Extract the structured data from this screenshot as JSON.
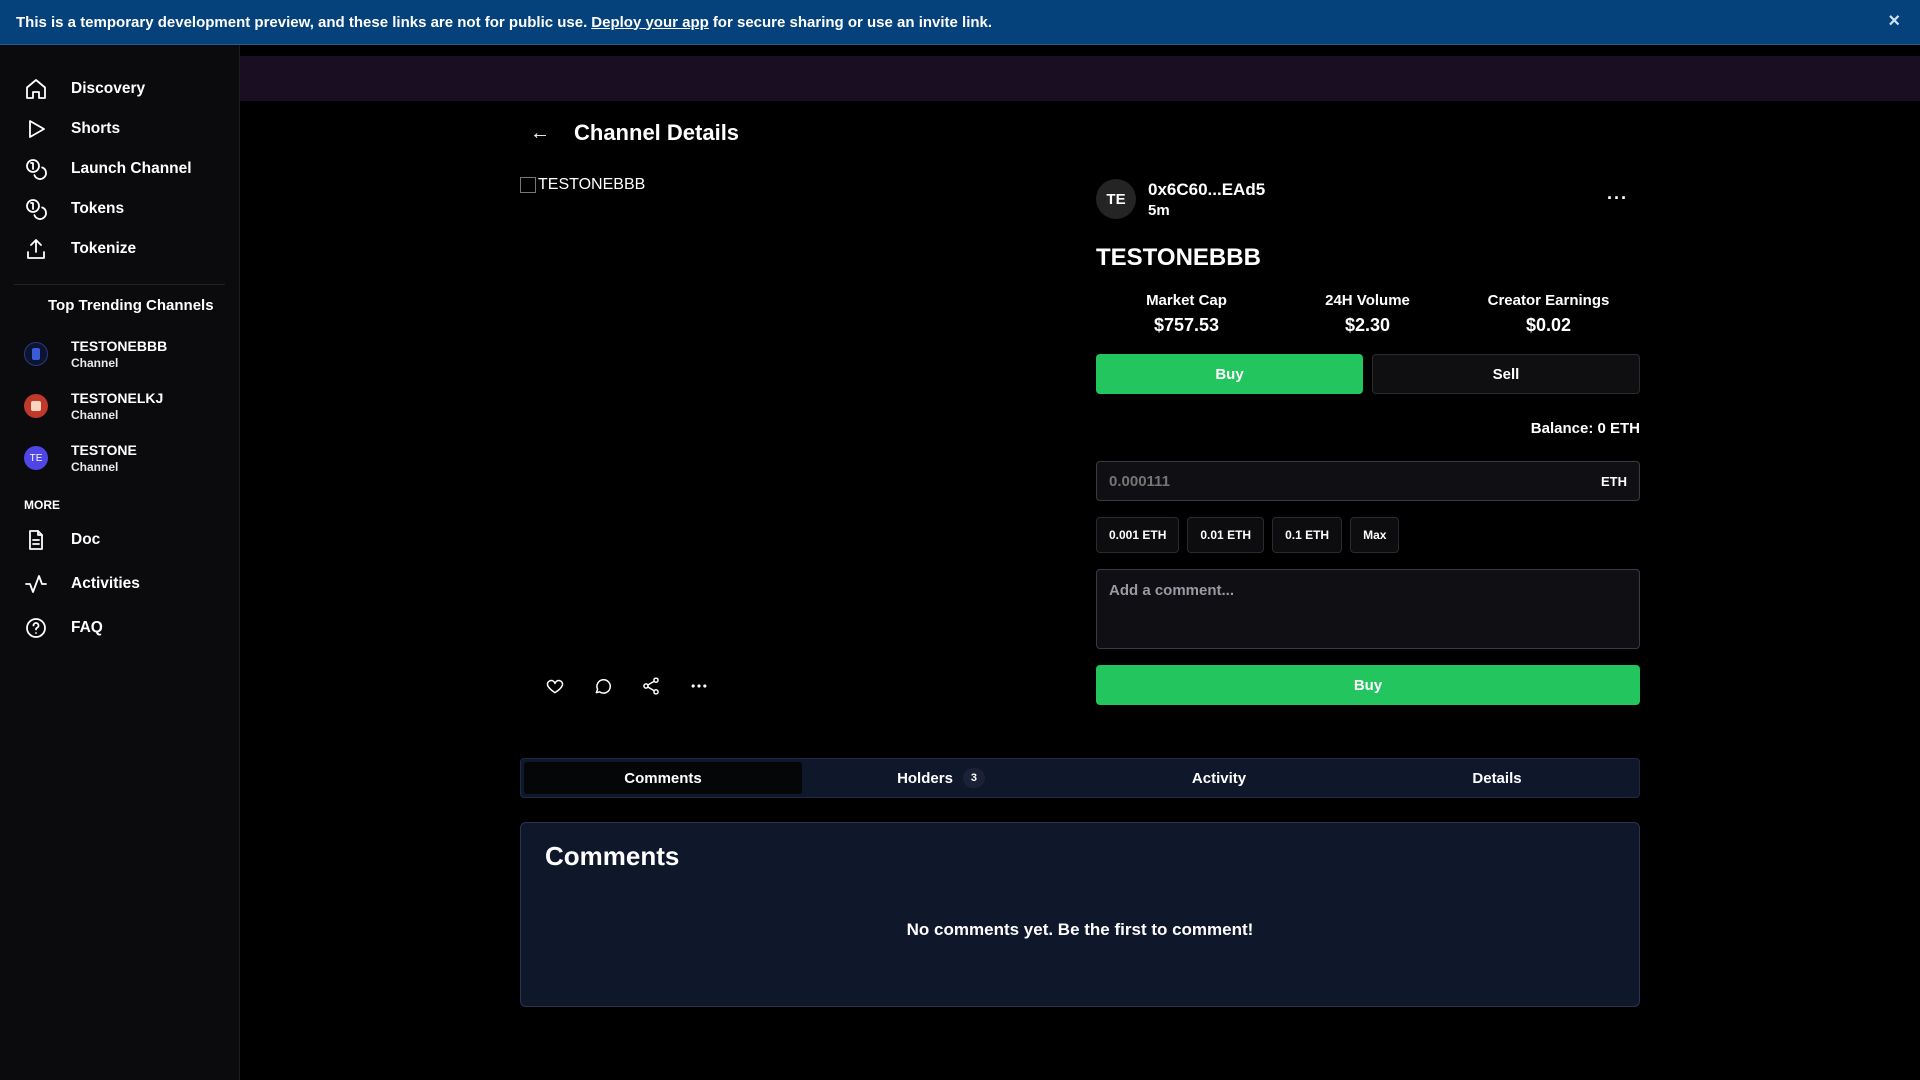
{
  "banner": {
    "text_before": "This is a temporary development preview, and these links are not for public use.",
    "link": "Deploy your app",
    "text_after": "for secure sharing or use an invite link.",
    "close": "×"
  },
  "sidebar": {
    "nav": [
      {
        "label": "Discovery",
        "icon": "home-icon"
      },
      {
        "label": "Shorts",
        "icon": "play-icon"
      },
      {
        "label": "Launch Channel",
        "icon": "coins-icon"
      },
      {
        "label": "Tokens",
        "icon": "coins-icon"
      },
      {
        "label": "Tokenize",
        "icon": "upload-icon"
      }
    ],
    "trending_title": "Top Trending Channels",
    "trending": [
      {
        "name": "TESTONEBBB",
        "sub": "Channel",
        "avatar": ""
      },
      {
        "name": "TESTONELKJ",
        "sub": "Channel",
        "avatar": ""
      },
      {
        "name": "TESTONE",
        "sub": "Channel",
        "avatar": "TE"
      }
    ],
    "more_title": "MORE",
    "more": [
      {
        "label": "Doc",
        "icon": "document-icon"
      },
      {
        "label": "Activities",
        "icon": "activity-icon"
      },
      {
        "label": "FAQ",
        "icon": "help-icon"
      }
    ]
  },
  "header": {
    "back": "←",
    "title": "Channel Details"
  },
  "media": {
    "alt": "TESTONEBBB"
  },
  "creator": {
    "initials": "TE",
    "address": "0x6C60...EAd5",
    "time": "5m",
    "menu": "···"
  },
  "token": {
    "name": "TESTONEBBB"
  },
  "stats": [
    {
      "label": "Market Cap",
      "value": "$757.53"
    },
    {
      "label": "24H Volume",
      "value": "$2.30"
    },
    {
      "label": "Creator Earnings",
      "value": "$0.02"
    }
  ],
  "trade": {
    "buy": "Buy",
    "sell": "Sell",
    "balance": "Balance: 0 ETH",
    "amount_placeholder": "0.000111",
    "unit": "ETH",
    "presets": [
      "0.001 ETH",
      "0.01 ETH",
      "0.1 ETH",
      "Max"
    ],
    "comment_placeholder": "Add a comment...",
    "submit": "Buy"
  },
  "tabs": [
    {
      "label": "Comments",
      "count": ""
    },
    {
      "label": "Holders",
      "count": "3"
    },
    {
      "label": "Activity",
      "count": ""
    },
    {
      "label": "Details",
      "count": ""
    }
  ],
  "comments": {
    "heading": "Comments",
    "empty": "No comments yet. Be the first to comment!"
  },
  "colors": {
    "accent_green": "#22c55e",
    "banner_blue": "#05417a",
    "panel_navy": "#0f172a"
  }
}
